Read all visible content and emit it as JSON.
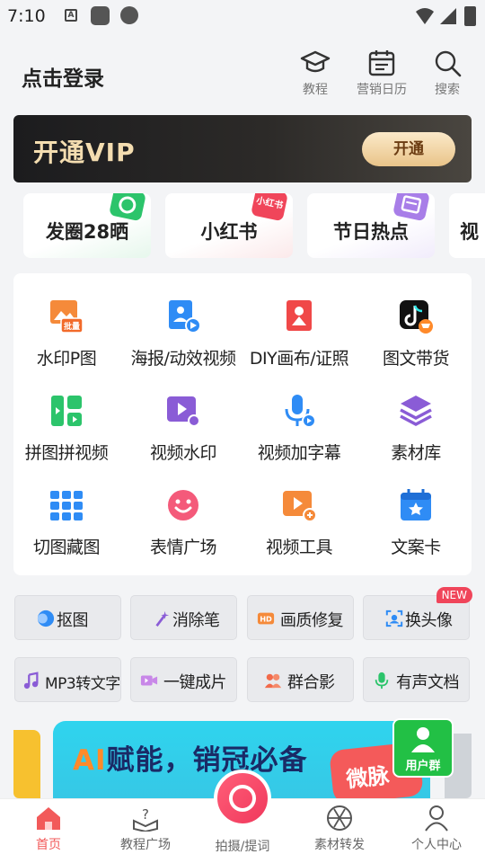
{
  "status_bar": {
    "time": "7:10",
    "a_badge": "A"
  },
  "header": {
    "login_text": "点击登录",
    "actions": [
      {
        "label": "教程",
        "icon": "graduation-cap-icon"
      },
      {
        "label": "营销日历",
        "icon": "calendar-icon"
      },
      {
        "label": "搜索",
        "icon": "search-icon"
      }
    ]
  },
  "vip_banner": {
    "title": "开通VIP",
    "button": "开通"
  },
  "topics": [
    {
      "label": "发圈28晒",
      "badge": "camera-badge-icon",
      "badge_color": "#2cc46b"
    },
    {
      "label": "小红书",
      "badge_text": "小红书",
      "badge_color": "#f0455a"
    },
    {
      "label": "节日热点",
      "badge": "calendar-badge-icon",
      "badge_color": "#a87ee8"
    },
    {
      "label": "视"
    }
  ],
  "tools": [
    {
      "label": "水印P图",
      "icon": "watermark-photo-icon",
      "icon_badge": "批量"
    },
    {
      "label": "海报/动效视频",
      "icon": "poster-video-icon"
    },
    {
      "label": "DIY画布/证照",
      "icon": "diy-canvas-icon"
    },
    {
      "label": "图文带货",
      "icon": "tiktok-cart-icon"
    },
    {
      "label": "拼图拼视频",
      "icon": "collage-icon"
    },
    {
      "label": "视频水印",
      "icon": "video-watermark-icon"
    },
    {
      "label": "视频加字幕",
      "icon": "microphone-icon"
    },
    {
      "label": "素材库",
      "icon": "layers-icon"
    },
    {
      "label": "切图藏图",
      "icon": "grid-cut-icon"
    },
    {
      "label": "表情广场",
      "icon": "emoji-icon"
    },
    {
      "label": "视频工具",
      "icon": "video-tool-icon"
    },
    {
      "label": "文案卡",
      "icon": "star-calendar-icon"
    }
  ],
  "quick_tools": [
    {
      "label": "抠图",
      "icon": "cutout-icon"
    },
    {
      "label": "消除笔",
      "icon": "magic-wand-icon"
    },
    {
      "label": "画质修复",
      "icon": "hd-icon"
    },
    {
      "label": "换头像",
      "icon": "face-scan-icon",
      "tag": "NEW"
    },
    {
      "label": "MP3转文字",
      "icon": "music-note-icon"
    },
    {
      "label": "一键成片",
      "icon": "video-camera-icon"
    },
    {
      "label": "群合影",
      "icon": "group-people-icon"
    },
    {
      "label": "有声文档",
      "icon": "mic-doc-icon"
    }
  ],
  "promo": {
    "ai": "AI",
    "title": "赋能，销冠必备",
    "red_text": "微脉",
    "user_group": "用户群"
  },
  "tabbar": [
    {
      "label": "首页",
      "icon": "home-icon",
      "active": true
    },
    {
      "label": "教程广场",
      "icon": "tutorial-book-icon"
    },
    {
      "label": "拍摄/提词",
      "icon": "camera-icon"
    },
    {
      "label": "素材转发",
      "icon": "aperture-icon"
    },
    {
      "label": "个人中心",
      "icon": "user-icon"
    }
  ],
  "colors": {
    "accent": "#f25a5a",
    "vip_gold": "#f4ddb0",
    "icon_blue": "#2f8cf5",
    "icon_orange": "#f58a3a",
    "icon_purple": "#8a5cd6",
    "icon_green": "#2cc46b"
  }
}
